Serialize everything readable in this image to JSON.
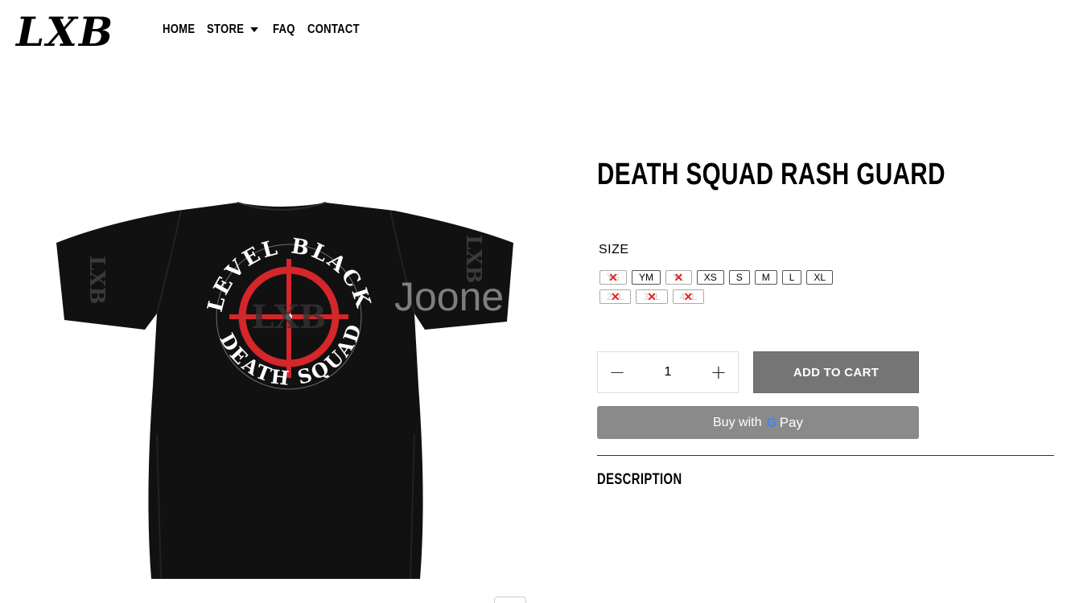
{
  "header": {
    "logo": "LXB",
    "nav": [
      {
        "label": "HOME"
      },
      {
        "label": "STORE"
      },
      {
        "label": "FAQ"
      },
      {
        "label": "CONTACT"
      }
    ]
  },
  "product": {
    "title": "DEATH SQUAD RASH GUARD",
    "image": {
      "ring_text_top": "LEVEL BLACK",
      "ring_text_bottom": "DEATH SQUAD",
      "center_text": "LXB",
      "sleeve_text": "LXB",
      "watermark": "Joone"
    },
    "size_label": "SIZE",
    "sizes_row1": [
      {
        "label": "YS",
        "available": false
      },
      {
        "label": "YM",
        "available": true
      },
      {
        "label": "YL",
        "available": false
      },
      {
        "label": "XS",
        "available": true
      },
      {
        "label": "S",
        "available": true
      },
      {
        "label": "M",
        "available": true
      },
      {
        "label": "L",
        "available": true
      },
      {
        "label": "XL",
        "available": true
      }
    ],
    "sizes_row2": [
      {
        "label": "2XL",
        "available": false
      },
      {
        "label": "3XL",
        "available": false
      },
      {
        "label": "4XL",
        "available": false
      }
    ],
    "quantity": "1",
    "qty_minus": "−",
    "qty_plus": "+",
    "add_to_cart": "ADD TO CART",
    "gpay": {
      "prefix": "Buy with",
      "g": "G",
      "pay": "Pay"
    },
    "description_label": "DESCRIPTION"
  },
  "colors": {
    "accent_red": "#d4262b",
    "button_gray": "#757575",
    "gpay_gray": "#8a8a8a"
  }
}
